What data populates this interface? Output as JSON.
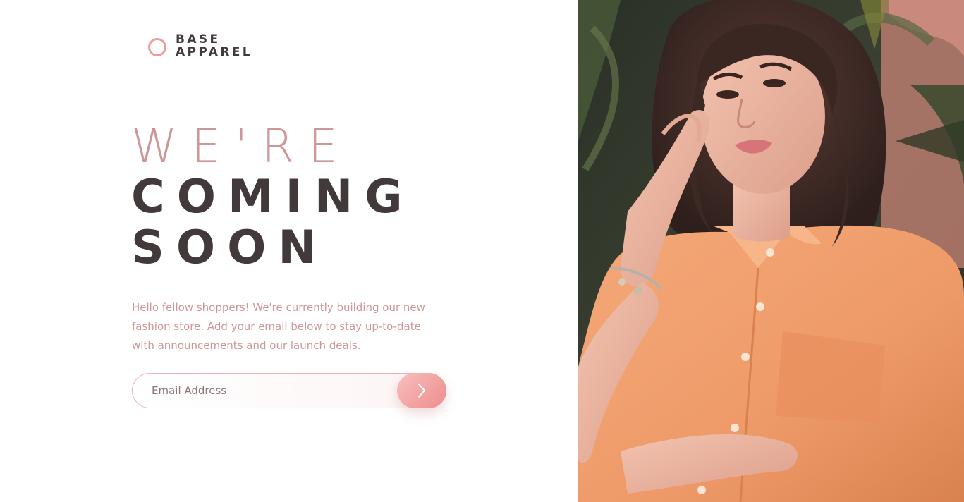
{
  "brand": {
    "line1": "BASE",
    "line2": "APPAREL",
    "accent_color": "#ee9c9c",
    "text_color": "#423a3a"
  },
  "headline": {
    "line1": "WE'RE",
    "line2": "COMING",
    "line3": "SOON"
  },
  "intro": {
    "text": "Hello fellow shoppers! We're currently building our new fashion store. Add your email below to stay up-to-date with announcements and our launch deals."
  },
  "form": {
    "email_placeholder": "Email Address",
    "submit_icon": "chevron-right-icon"
  },
  "hero": {
    "image": "woman-in-peach-shirt-photo"
  },
  "colors": {
    "desaturated_red": "#ce9797",
    "dark_grayish_red": "#423a3a",
    "gradient_start": "#f8bfbf",
    "gradient_end": "#ee8c8c"
  }
}
